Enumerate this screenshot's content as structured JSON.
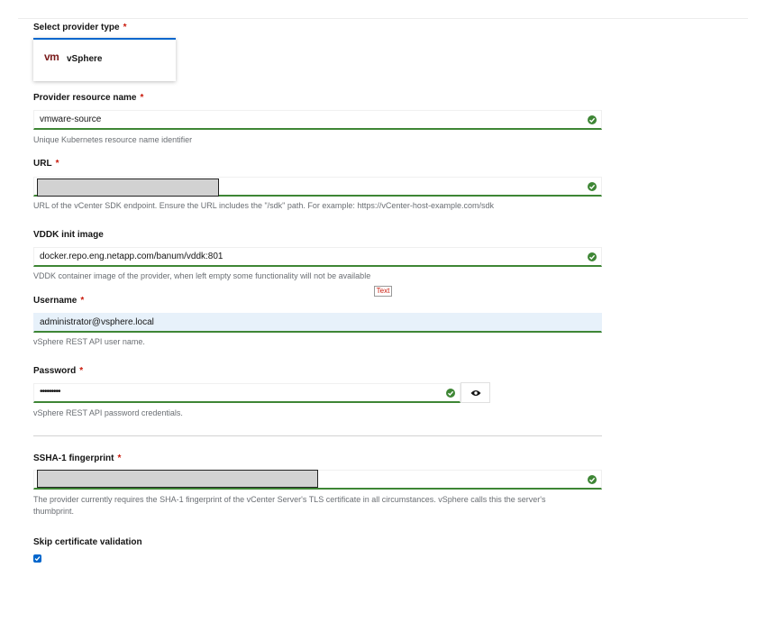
{
  "provider_type": {
    "label": "Select provider type",
    "required": "*",
    "tile_logo": "vm",
    "tile_name": "vSphere",
    "accent": "#0066cc"
  },
  "resource_name": {
    "label": "Provider resource name",
    "required": "*",
    "value": "vmware-source",
    "helper": "Unique Kubernetes resource name identifier"
  },
  "url": {
    "label": "URL",
    "required": "*",
    "value": "",
    "helper": "URL of the vCenter SDK endpoint. Ensure the URL includes the \"/sdk\" path. For example: https://vCenter-host-example.com/sdk"
  },
  "vddk": {
    "label": "VDDK init image",
    "value": "docker.repo.eng.netapp.com/banum/vddk:801",
    "helper": "VDDK container image of the provider, when left empty some functionality will not be available"
  },
  "annotation": {
    "text": "Text"
  },
  "username": {
    "label": "Username",
    "required": "*",
    "value": "administrator@vsphere.local",
    "helper": "vSphere REST API user name."
  },
  "password": {
    "label": "Password",
    "required": "*",
    "value": "•••••••••",
    "helper": "vSphere REST API password credentials."
  },
  "fingerprint": {
    "label": "SSHA-1 fingerprint",
    "required": "*",
    "value": "",
    "helper": "The provider currently requires the SHA-1 fingerprint of the vCenter Server's TLS certificate in all circumstances. vSphere calls this the server's thumbprint."
  },
  "skip_cert": {
    "label": "Skip certificate validation",
    "checked": true
  },
  "icons": {
    "valid": "check-circle-icon",
    "reveal": "eye-icon",
    "checkbox": "check-icon"
  },
  "colors": {
    "success": "#3e8635",
    "required": "#c9190b",
    "brand": "#7b1d1d",
    "checkbox": "#0066cc",
    "highlight": "#e7f1fa"
  }
}
